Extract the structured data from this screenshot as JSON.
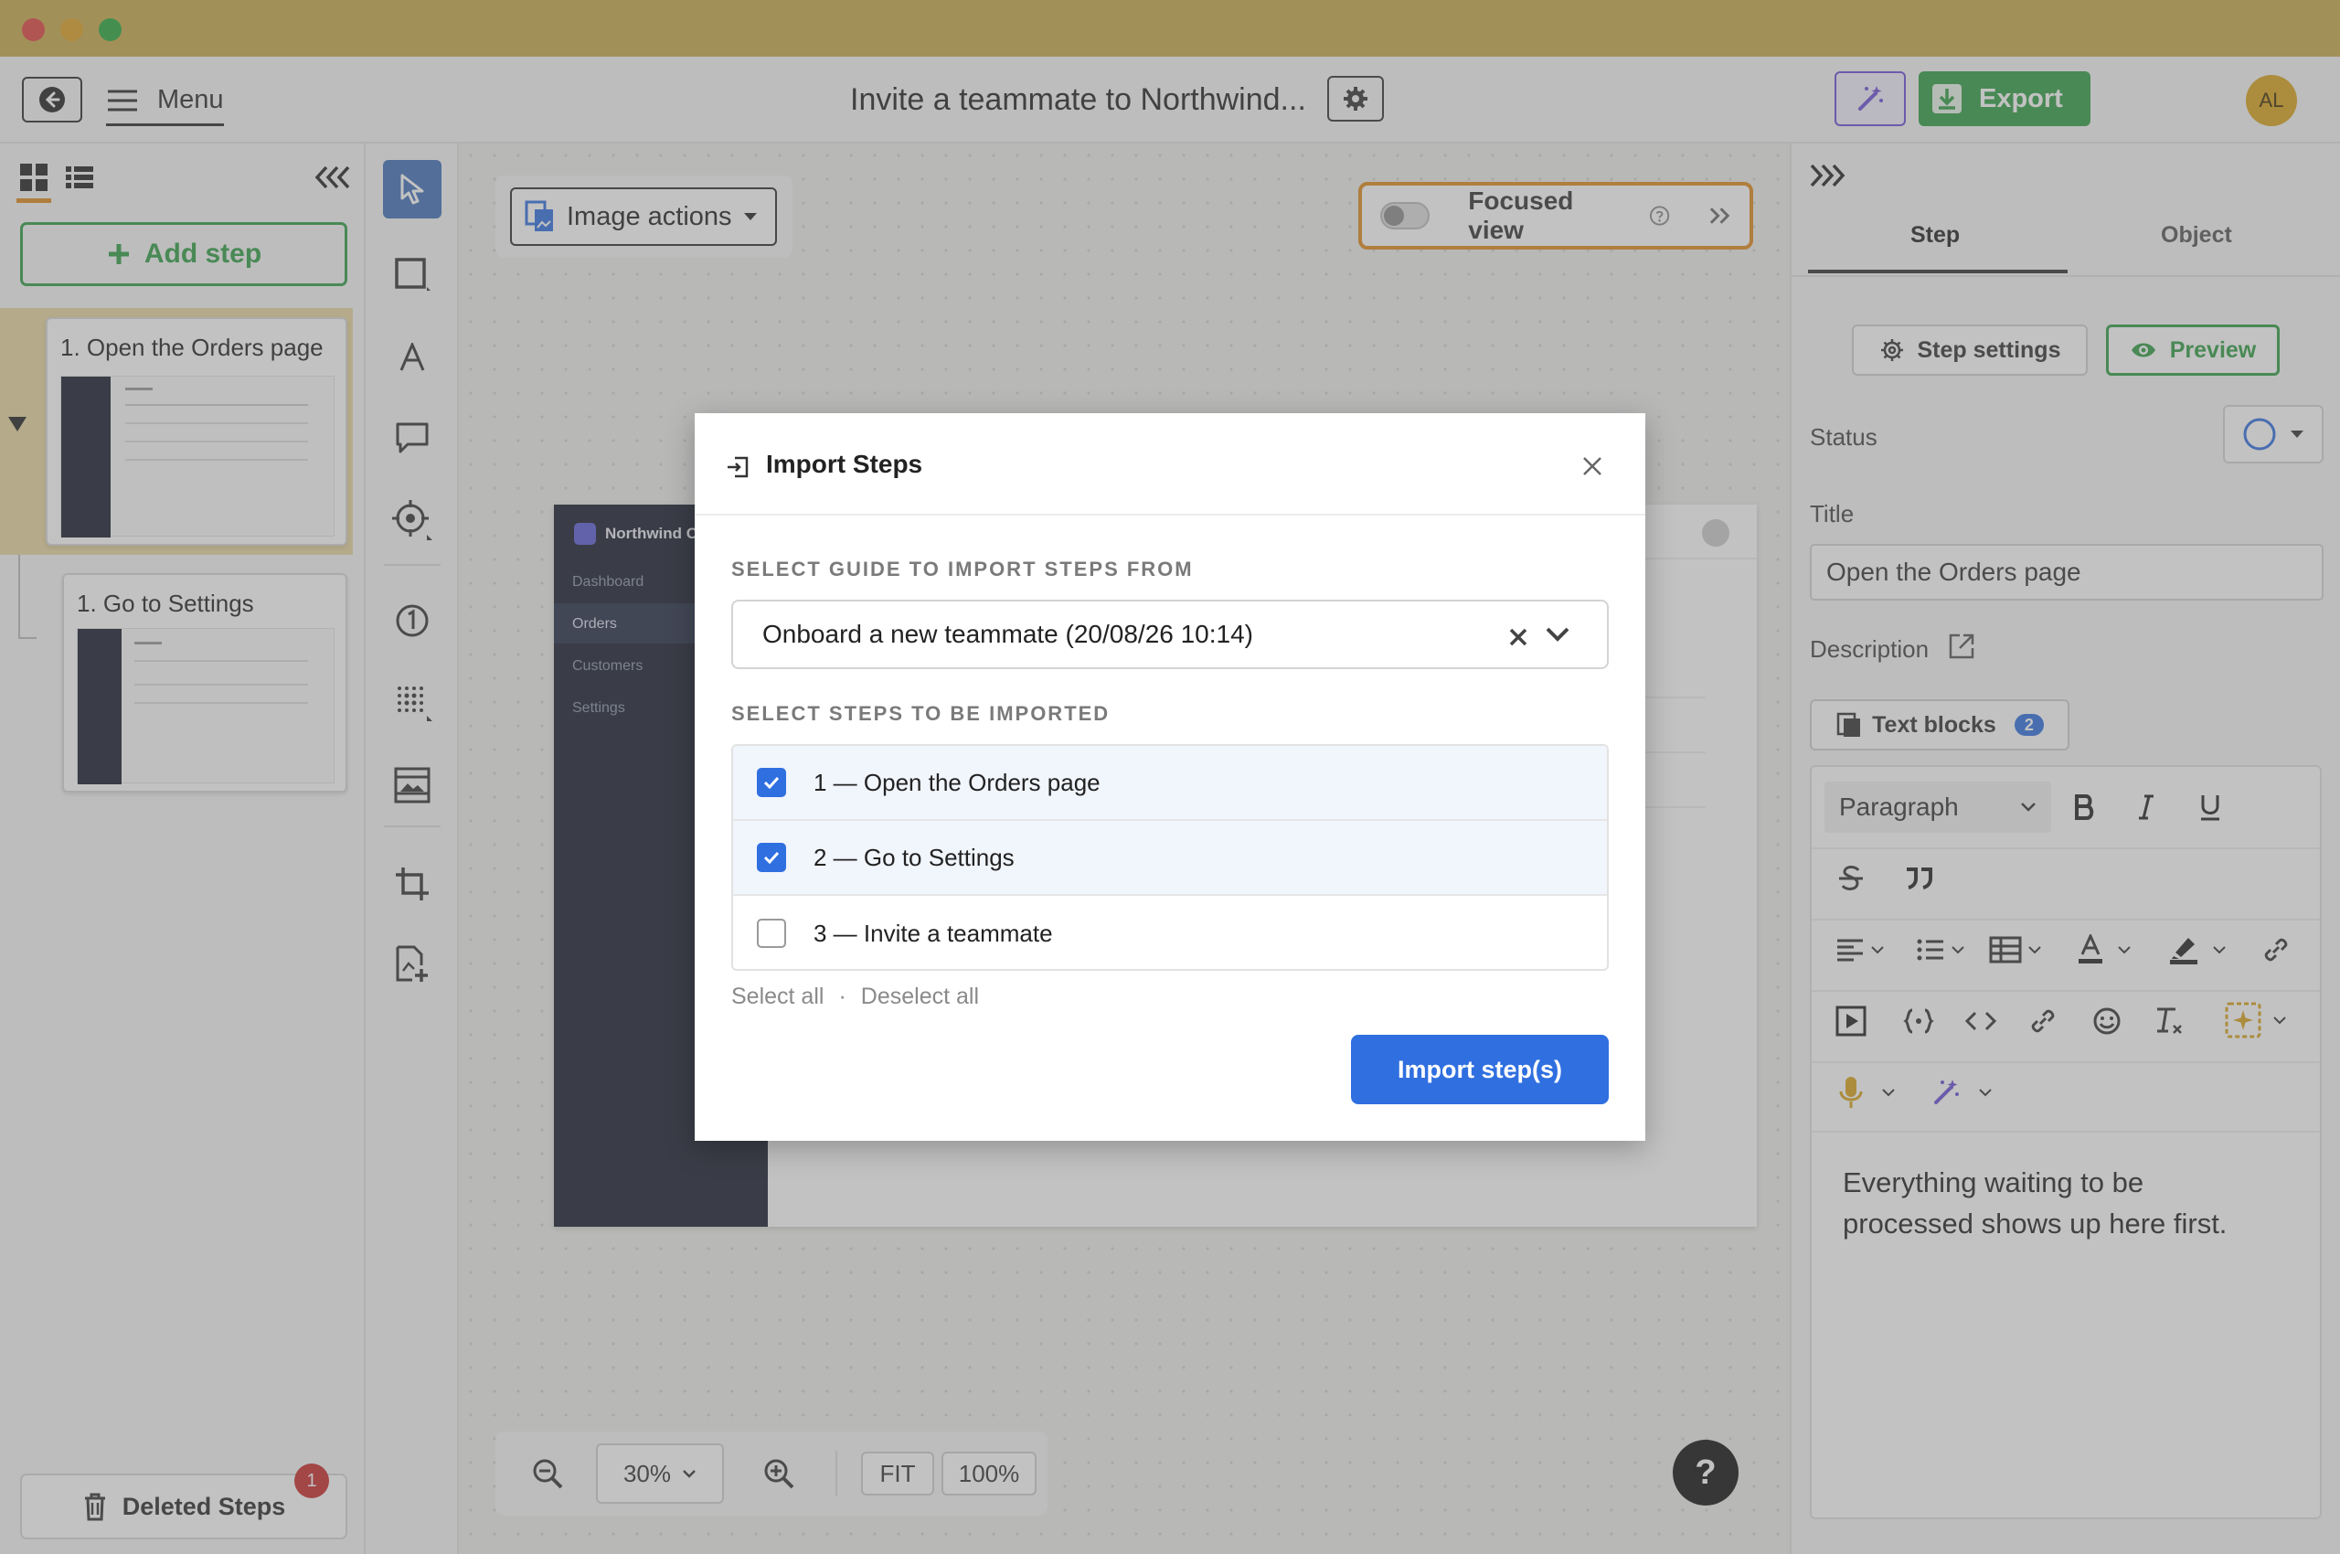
{
  "header": {
    "menu_label": "Menu",
    "doc_title": "Invite a teammate to Northwind...",
    "export_label": "Export",
    "avatar_initials": "AL"
  },
  "left_panel": {
    "add_step_label": "Add step",
    "steps": [
      {
        "title": "1. Open the Orders page"
      },
      {
        "title": "1. Go to Settings"
      }
    ],
    "deleted_label": "Deleted Steps",
    "deleted_count": "1"
  },
  "canvas": {
    "image_actions_label": "Image actions",
    "focused_view_label": "Focused view",
    "screenshot": {
      "brand": "Northwind Op",
      "nav": [
        "Dashboard",
        "Orders",
        "Customers",
        "Settings"
      ]
    },
    "zoom_value": "30%",
    "fit_label": "FIT",
    "hundred_label": "100%",
    "help_label": "?"
  },
  "right_panel": {
    "tabs": [
      "Step",
      "Object"
    ],
    "step_settings_label": "Step settings",
    "preview_label": "Preview",
    "status_label": "Status",
    "title_label": "Title",
    "title_value": "Open the Orders page",
    "description_label": "Description",
    "text_blocks_label": "Text blocks",
    "text_blocks_count": "2",
    "paragraph_label": "Paragraph",
    "editor_text": "Everything waiting to be processed shows up here first."
  },
  "modal": {
    "title": "Import Steps",
    "guide_section_label": "SELECT GUIDE TO IMPORT STEPS FROM",
    "guide_value": "Onboard a new teammate (20/08/26 10:14)",
    "steps_section_label": "SELECT STEPS TO BE IMPORTED",
    "steps": [
      {
        "label": "1 — Open the Orders page",
        "checked": true
      },
      {
        "label": "2 — Go to Settings",
        "checked": true
      },
      {
        "label": "3 — Invite a teammate",
        "checked": false
      }
    ],
    "select_all_label": "Select all",
    "separator": "·",
    "deselect_all_label": "Deselect all",
    "import_button_label": "Import step(s)"
  },
  "colors": {
    "titlebar": "#c9a94b",
    "green": "#2f9e44",
    "blue": "#2f6fe0",
    "orange_outline": "#e08a1b",
    "purple": "#6b4fd8"
  }
}
